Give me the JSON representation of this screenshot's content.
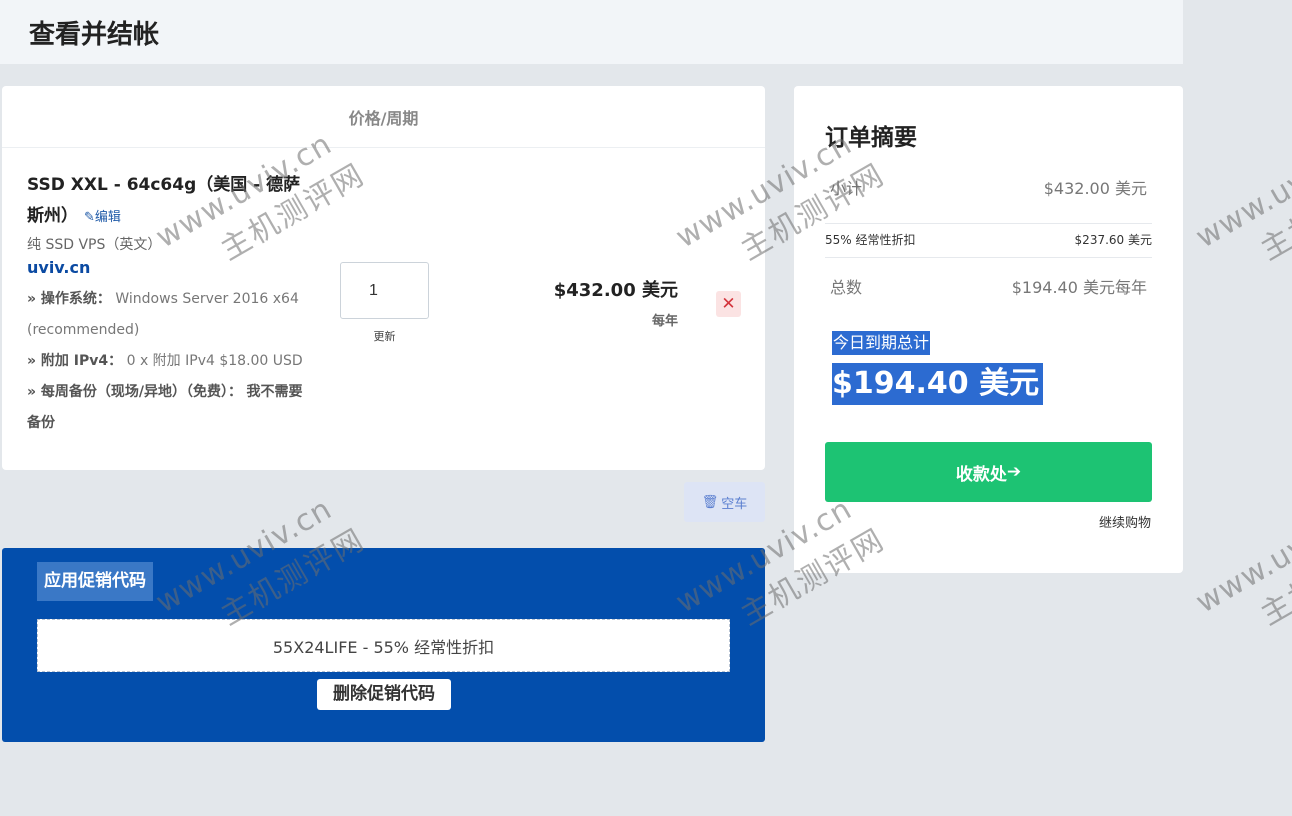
{
  "page": {
    "title": "查看并结帐"
  },
  "cart": {
    "column_header": "价格/周期",
    "product": {
      "name": "SSD XXL - 64c64g（美国 - 德萨斯州）",
      "edit_label": "编辑",
      "group": "纯 SSD VPS（英文）",
      "domain": "uviv.cn",
      "config": [
        {
          "label": "» 操作系统：",
          "value": "Windows Server 2016 x64 (recommended)"
        },
        {
          "label": "» 附加 IPv4：",
          "value": "0 x 附加 IPv4 $18.00 USD"
        },
        {
          "label": "» 每周备份（现场/异地）（免费）：",
          "value": "我不需要备份"
        }
      ],
      "quantity": "1",
      "update_label": "更新",
      "price": "$432.00 美元",
      "cycle": "每年",
      "remove_icon": "close-icon"
    },
    "empty_cart_label": "空车",
    "empty_cart_icon": "trash-icon"
  },
  "promo": {
    "title": "应用促销代码",
    "code_text": "55X24LIFE - 55% 经常性折扣",
    "remove_label": "删除促销代码"
  },
  "summary": {
    "title": "订单摘要",
    "subtotal_label": "小计",
    "subtotal_value": "$432.00 美元",
    "discount_label": "55% 经常性折扣",
    "discount_value": "$237.60 美元",
    "total_label": "总数",
    "total_value": "$194.40 美元每年",
    "due_today_label": "今日到期总计",
    "due_today_value": "$194.40 美元",
    "checkout_label": "收款处",
    "checkout_icon": "arrow-right-icon",
    "continue_label": "继续购物"
  },
  "watermark": {
    "url": "www.uviv.cn",
    "text": "主机测评网"
  },
  "colors": {
    "background": "#e3e7eb",
    "promo_blue": "#034eac",
    "checkout_green": "#1dc373",
    "highlight_blue": "#2c6bd1",
    "remove_red": "#d3343c"
  }
}
